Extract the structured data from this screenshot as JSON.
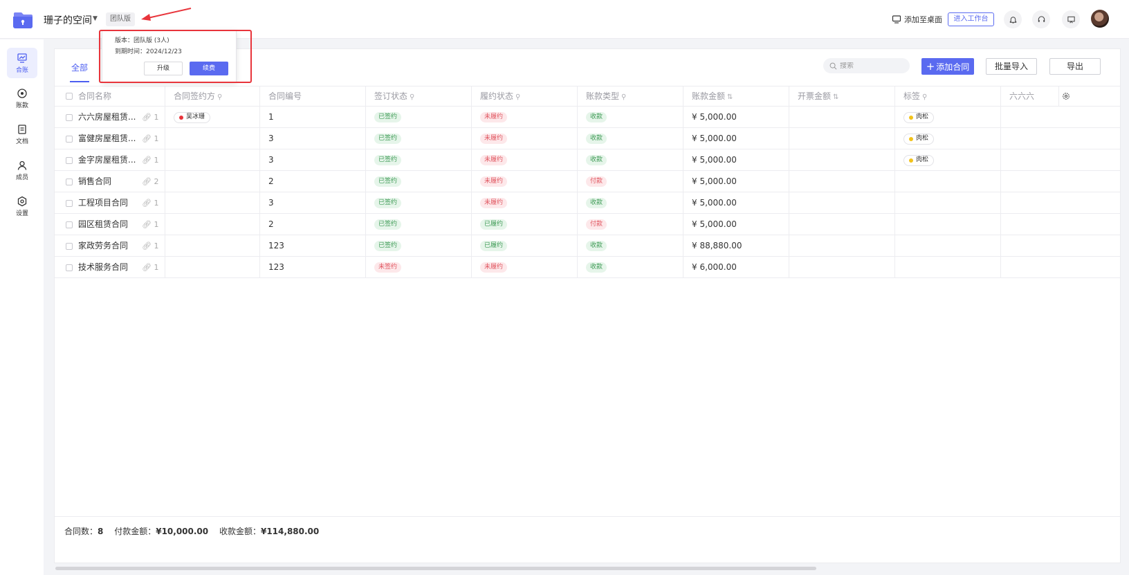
{
  "header": {
    "space_title": "珊子的空间",
    "edition_badge": "团队版",
    "add_to_desktop": "添加至桌面",
    "enter_workbench": "进入工作台"
  },
  "popover": {
    "version_line": "版本：团队版 (3人)",
    "expire_line": "到期时间：2024/12/23",
    "upgrade": "升级",
    "renew": "续费"
  },
  "sidebar": {
    "items": [
      {
        "label": "合账",
        "icon": "chart-icon",
        "active": true
      },
      {
        "label": "账款",
        "icon": "target-icon",
        "active": false
      },
      {
        "label": "文档",
        "icon": "document-icon",
        "active": false
      },
      {
        "label": "成员",
        "icon": "user-icon",
        "active": false
      },
      {
        "label": "设置",
        "icon": "settings-icon",
        "active": false
      }
    ]
  },
  "toolbar": {
    "tab_all": "全部",
    "search_placeholder": "搜索",
    "add_contract": "添加合同",
    "batch_import": "批量导入",
    "export": "导出"
  },
  "table": {
    "columns": [
      "合同名称",
      "合同签约方",
      "合同编号",
      "签订状态",
      "履约状态",
      "账款类型",
      "账款金额",
      "开票金额",
      "标签",
      "六六六"
    ],
    "rows": [
      {
        "name": "六六房屋租赁...",
        "attachments": "1",
        "party": "吴冰珊",
        "number": "1",
        "sign": "已签约",
        "perform": "未履约",
        "type": "收款",
        "amount": "¥ 5,000.00",
        "invoice": "",
        "tag": "肉松"
      },
      {
        "name": "富健房屋租赁...",
        "attachments": "1",
        "party": "",
        "number": "3",
        "sign": "已签约",
        "perform": "未履约",
        "type": "收款",
        "amount": "¥ 5,000.00",
        "invoice": "",
        "tag": "肉松"
      },
      {
        "name": "金字房屋租赁...",
        "attachments": "1",
        "party": "",
        "number": "3",
        "sign": "已签约",
        "perform": "未履约",
        "type": "收款",
        "amount": "¥ 5,000.00",
        "invoice": "",
        "tag": "肉松"
      },
      {
        "name": "销售合同",
        "attachments": "2",
        "party": "",
        "number": "2",
        "sign": "已签约",
        "perform": "未履约",
        "type": "付款",
        "amount": "¥ 5,000.00",
        "invoice": "",
        "tag": ""
      },
      {
        "name": "工程项目合同",
        "attachments": "1",
        "party": "",
        "number": "3",
        "sign": "已签约",
        "perform": "未履约",
        "type": "收款",
        "amount": "¥ 5,000.00",
        "invoice": "",
        "tag": ""
      },
      {
        "name": "园区租赁合同",
        "attachments": "1",
        "party": "",
        "number": "2",
        "sign": "已签约",
        "perform": "已履约",
        "type": "付款",
        "amount": "¥ 5,000.00",
        "invoice": "",
        "tag": ""
      },
      {
        "name": "家政劳务合同",
        "attachments": "1",
        "party": "",
        "number": "123",
        "sign": "已签约",
        "perform": "已履约",
        "type": "收款",
        "amount": "¥ 88,880.00",
        "invoice": "",
        "tag": ""
      },
      {
        "name": "技术服务合同",
        "attachments": "1",
        "party": "",
        "number": "123",
        "sign": "未签约",
        "perform": "未履约",
        "type": "收款",
        "amount": "¥ 6,000.00",
        "invoice": "",
        "tag": ""
      }
    ]
  },
  "footer": {
    "count_label": "合同数：",
    "count_value": "8",
    "pay_label": "付款金额：",
    "pay_value": "¥10,000.00",
    "receive_label": "收款金额：",
    "receive_value": "¥114,880.00"
  },
  "colors": {
    "accent": "#5a6af0",
    "annotation_red": "#e8343b",
    "status_green": "#3f9b56",
    "status_red": "#e0555f",
    "party_dot": "#e8343b",
    "tag_dot": "#f2c21b"
  }
}
